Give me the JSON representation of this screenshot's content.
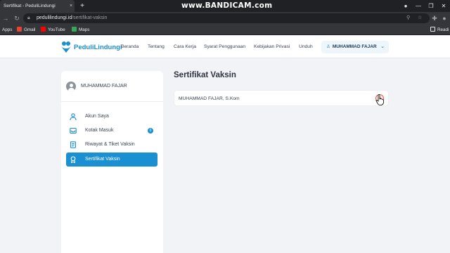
{
  "browser": {
    "tab_title": "Sertifikat - PeduliLindungi",
    "tab_close": "×",
    "new_tab": "+",
    "url_host": "pedulilindungi.id",
    "url_path": "/sertifikat-vaksin",
    "watermark": "www.BANDICAM.com",
    "bookmarks": {
      "apps": "Apps",
      "gmail": "Gmail",
      "youtube": "YouTube",
      "maps": "Maps",
      "reading": "Readi"
    }
  },
  "site": {
    "logo_text": "PeduliLindungi",
    "nav": {
      "beranda": "Beranda",
      "tentang": "Tentang",
      "cara_kerja": "Cara Kerja",
      "syarat": "Syarat Penggunaan",
      "kebijakan": "Kebijakan Privasi",
      "unduh": "Unduh"
    },
    "user_menu": "MUHAMMAD FAJAR",
    "brand_color": "#1a8fd1"
  },
  "sidebar": {
    "profile_name": "MUHAMMAD FAJAR",
    "items": [
      {
        "label": "Akun Saya",
        "icon": "user-icon"
      },
      {
        "label": "Kotak Masuk",
        "icon": "inbox-icon",
        "badge": "0"
      },
      {
        "label": "Riwayat & Tiket Vaksin",
        "icon": "history-icon"
      },
      {
        "label": "Sertifikat Vaksin",
        "icon": "certificate-icon",
        "active": true
      }
    ]
  },
  "main": {
    "title": "Sertifikat Vaksin",
    "certificates": [
      {
        "name": "MUHAMMAD FAJAR, S.Kom"
      }
    ]
  }
}
